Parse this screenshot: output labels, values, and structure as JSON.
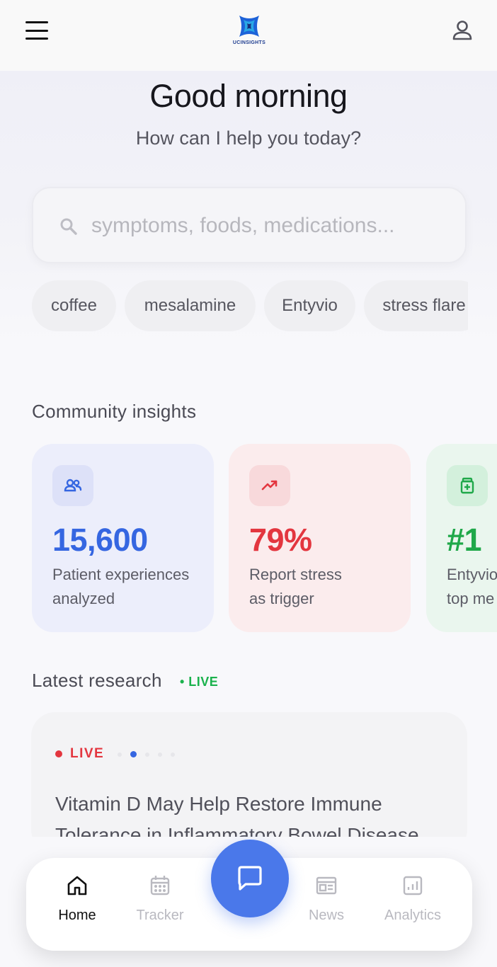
{
  "header": {
    "logo_text": "UCINSIGHTS",
    "menu_icon": "hamburger-icon",
    "profile_icon": "user-icon"
  },
  "hero": {
    "greeting": "Good morning",
    "subtitle": "How can I help you today?"
  },
  "search": {
    "placeholder": "symptoms, foods, medications...",
    "value": ""
  },
  "chips": [
    {
      "label": "coffee"
    },
    {
      "label": "mesalamine"
    },
    {
      "label": "Entyvio"
    },
    {
      "label": "stress flare"
    }
  ],
  "community": {
    "title": "Community insights",
    "cards": [
      {
        "icon": "users-icon",
        "value": "15,600",
        "label_line1": "Patient experiences",
        "label_line2": "analyzed",
        "accent": "#3566e1"
      },
      {
        "icon": "trending-up-icon",
        "value": "79%",
        "label_line1": "Report stress",
        "label_line2": "as trigger",
        "accent": "#e3363f"
      },
      {
        "icon": "medicine-bottle-icon",
        "value": "#1",
        "label_line1": "Entyvio",
        "label_line2": "top me",
        "accent": "#1fa849"
      }
    ]
  },
  "research": {
    "title": "Latest research",
    "live_tag": "• LIVE",
    "card_live_label": "LIVE",
    "headline": "Vitamin D May Help Restore Immune Tolerance in Inflammatory Bowel Disease"
  },
  "nav": {
    "items": [
      {
        "label": "Home",
        "icon": "home-icon",
        "active": true
      },
      {
        "label": "Tracker",
        "icon": "calendar-icon",
        "active": false
      },
      {
        "label": "News",
        "icon": "newspaper-icon",
        "active": false
      },
      {
        "label": "Analytics",
        "icon": "bar-chart-icon",
        "active": false
      }
    ],
    "fab_icon": "chat-icon"
  },
  "colors": {
    "primary": "#4a78ea",
    "live_green": "#1bb24d",
    "live_red": "#e3363f"
  }
}
